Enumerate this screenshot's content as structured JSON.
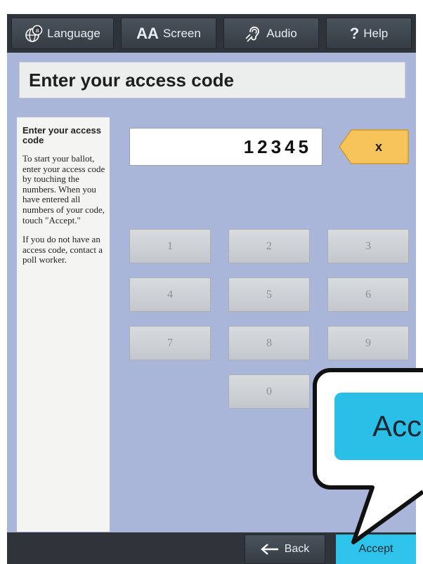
{
  "topbar": {
    "language_label": "Language",
    "screen_prefix": "AA",
    "screen_label": "Screen",
    "audio_label": "Audio",
    "help_prefix": "?",
    "help_label": "Help"
  },
  "title": "Enter your access code",
  "help": {
    "heading": "Enter your access code",
    "para1": "To start your ballot, enter your access code by touching the numbers.  When you have entered all numbers of your code, touch \"Accept.\"",
    "para2": "If you do not have an access code, contact a poll worker."
  },
  "code_value": "12345",
  "clear_label": "x",
  "keypad": [
    "1",
    "2",
    "3",
    "4",
    "5",
    "6",
    "7",
    "8",
    "9",
    "0"
  ],
  "bottombar": {
    "back_label": "Back",
    "accept_label": "Accept"
  },
  "callout_label": "Acc",
  "colors": {
    "panel_bg": "#a9b6d9",
    "bar_bg": "#2e343a",
    "accent_cyan": "#2dc3ea",
    "clear_yellow": "#f6c45a"
  },
  "icons": {
    "language": "globe-icon",
    "audio": "ear-icon",
    "back": "arrow-left-icon"
  }
}
